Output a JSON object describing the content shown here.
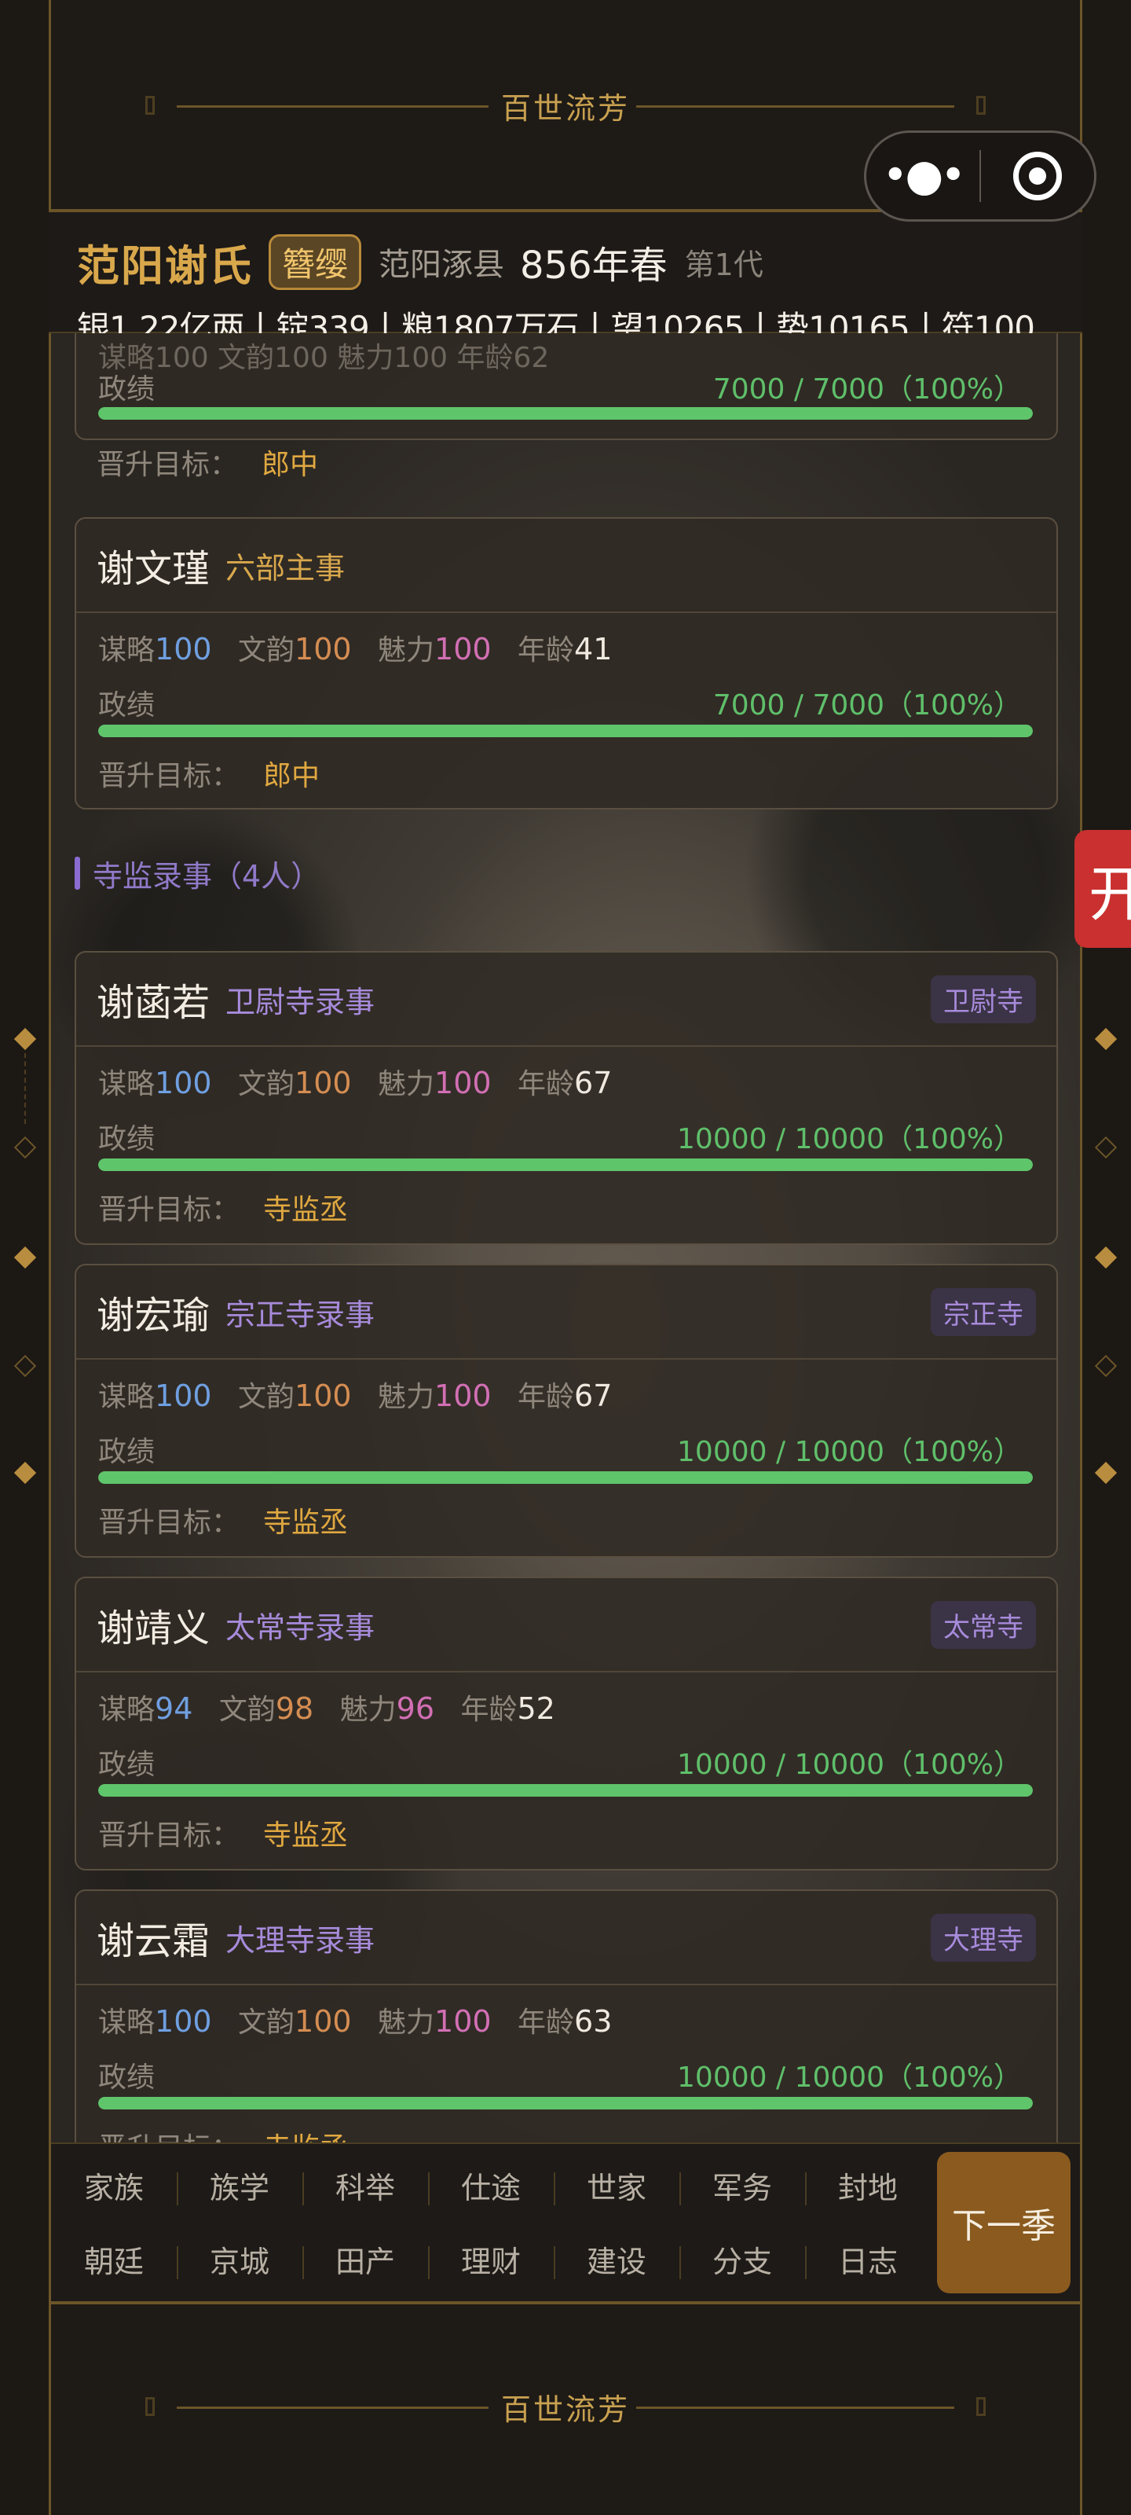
{
  "banner": {
    "top_title": "百世流芳",
    "bottom_title": "百世流芳"
  },
  "header": {
    "clan": "范阳谢氏",
    "rank": "簪缨",
    "place": "范阳涿县",
    "year": "856年春",
    "generation": "第1代",
    "resources": "银1.22亿两丨锭339丨粮1807万石丨望10265丨势10165丨符100"
  },
  "labels": {
    "strategy": "谋略",
    "literature": "文韵",
    "charm": "魅力",
    "age": "年龄",
    "performance": "政绩",
    "promotion": "晋升目标："
  },
  "partial_card": {
    "stats_fragment": "谋略100 文韵100 魅力100 年龄62",
    "performance": "7000 / 7000（100%）",
    "progress": 1.0,
    "target": "郎中"
  },
  "officials_top": [
    {
      "name": "谢文瑾",
      "title": "六部主事",
      "strategy": "100",
      "literature": "100",
      "charm": "100",
      "age": "41",
      "performance": "7000 / 7000（100%）",
      "progress": 1.0,
      "target": "郎中"
    }
  ],
  "section": {
    "label": "寺监录事（4人）"
  },
  "officials": [
    {
      "name": "谢菡若",
      "title": "卫尉寺录事",
      "dept": "卫尉寺",
      "strategy": "100",
      "literature": "100",
      "charm": "100",
      "age": "67",
      "performance": "10000 / 10000（100%）",
      "progress": 1.0,
      "target": "寺监丞"
    },
    {
      "name": "谢宏瑜",
      "title": "宗正寺录事",
      "dept": "宗正寺",
      "strategy": "100",
      "literature": "100",
      "charm": "100",
      "age": "67",
      "performance": "10000 / 10000（100%）",
      "progress": 1.0,
      "target": "寺监丞"
    },
    {
      "name": "谢靖义",
      "title": "太常寺录事",
      "dept": "太常寺",
      "strategy": "94",
      "literature": "98",
      "charm": "96",
      "age": "52",
      "performance": "10000 / 10000（100%）",
      "progress": 1.0,
      "target": "寺监丞"
    },
    {
      "name": "谢云霜",
      "title": "大理寺录事",
      "dept": "大理寺",
      "strategy": "100",
      "literature": "100",
      "charm": "100",
      "age": "63",
      "performance": "10000 / 10000（100%）",
      "progress": 1.0,
      "target": "寺监丞"
    }
  ],
  "side_tab": {
    "label": "开"
  },
  "nav": {
    "row1": [
      "家族",
      "族学",
      "科举",
      "仕途",
      "世家",
      "军务",
      "封地"
    ],
    "row2": [
      "朝廷",
      "京城",
      "田产",
      "理财",
      "建设",
      "分支",
      "日志"
    ],
    "next_label": "下一季"
  },
  "colors": {
    "gold": "#d9a84c",
    "purple": "#a78bdb",
    "progress_green": "#5fc56b",
    "strategy_blue": "#6f9fe0",
    "literature_orange": "#d58d52",
    "charm_pink": "#d26fb4",
    "next_button": "#8a5a1f",
    "side_tab_red": "#c9302f"
  }
}
